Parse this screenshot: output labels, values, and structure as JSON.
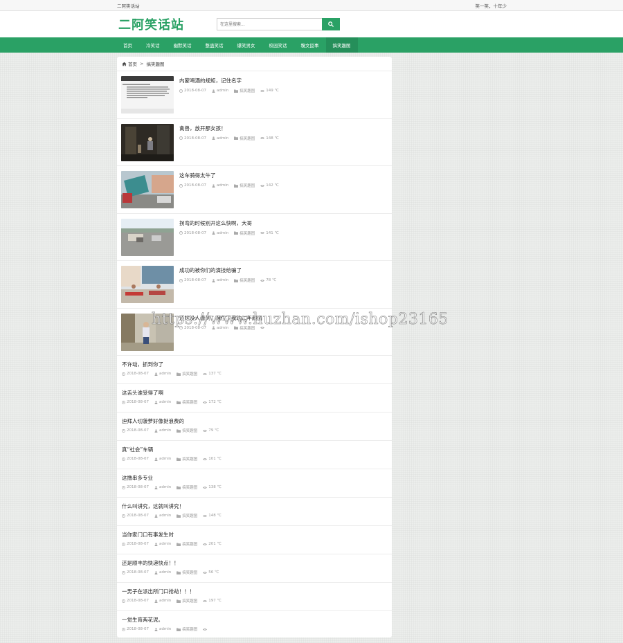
{
  "topbar": {
    "site_name": "二阿笑话站",
    "slogan": "笑一笑，十年少"
  },
  "header": {
    "logo": "二阿笑话站"
  },
  "search": {
    "placeholder": "在这里搜索..."
  },
  "nav": [
    "首页",
    "冷笑话",
    "幽默笑话",
    "整蛊笑话",
    "爆笑男女",
    "校园笑话",
    "糗文囧事",
    "搞笑趣图"
  ],
  "breadcrumb": {
    "home": "首页",
    "separator": ">",
    "current": "搞笑趣图"
  },
  "posts_with_image": [
    {
      "title": "内蒙喝酒的规矩，记住名字",
      "date": "2018-08-07",
      "author": "admin",
      "category": "搞笑趣图",
      "views": "149 ℃",
      "thumb": "chat-screenshot"
    },
    {
      "title": "禽兽，放开那女孩！",
      "date": "2018-08-07",
      "author": "admin",
      "category": "搞笑趣图",
      "views": "148 ℃",
      "thumb": "dark-room"
    },
    {
      "title": "这车骑得太牛了",
      "date": "2018-08-07",
      "author": "admin",
      "category": "搞笑趣图",
      "views": "142 ℃",
      "thumb": "street-truck"
    },
    {
      "title": "拐弯的时候别开这么快啊，大哥",
      "date": "2018-08-07",
      "author": "admin",
      "category": "搞笑趣图",
      "views": "141 ℃",
      "thumb": "road"
    },
    {
      "title": "成功的被你们的演技给骗了",
      "date": "2018-08-07",
      "author": "admin",
      "category": "搞笑趣图",
      "views": "78 ℃",
      "thumb": "shop-front"
    },
    {
      "title": "还好没人看到，保住了我的二年颜面",
      "date": "2018-08-07",
      "author": "admin",
      "category": "搞笑趣图",
      "views": "",
      "thumb": "indoor-kid"
    }
  ],
  "posts_text": [
    {
      "title": "不许动，抓到你了",
      "date": "2018-08-07",
      "author": "admin",
      "category": "搞笑趣图",
      "views": "137 ℃"
    },
    {
      "title": "这舌头谁受得了啊",
      "date": "2018-08-07",
      "author": "admin",
      "category": "搞笑趣图",
      "views": "172 ℃"
    },
    {
      "title": "迪拜人切菠萝好像挺浪费的",
      "date": "2018-08-07",
      "author": "admin",
      "category": "搞笑趣图",
      "views": "79 ℃"
    },
    {
      "title": "真“社会”车辆",
      "date": "2018-08-07",
      "author": "admin",
      "category": "搞笑趣图",
      "views": "101 ℃"
    },
    {
      "title": "这撸串多专业",
      "date": "2018-08-07",
      "author": "admin",
      "category": "搞笑趣图",
      "views": "138 ℃"
    },
    {
      "title": "什么叫讲究，这就叫讲究！",
      "date": "2018-08-07",
      "author": "admin",
      "category": "搞笑趣图",
      "views": "148 ℃"
    },
    {
      "title": "当你家门口有事发生时",
      "date": "2018-08-07",
      "author": "admin",
      "category": "搞笑趣图",
      "views": "201 ℃"
    },
    {
      "title": "还是顺丰的快递快点！！",
      "date": "2018-08-07",
      "author": "admin",
      "category": "搞笑趣图",
      "views": "56 ℃"
    },
    {
      "title": "一男子在派出所门口抢劫！！！",
      "date": "2018-08-07",
      "author": "admin",
      "category": "搞笑趣图",
      "views": "197 ℃"
    },
    {
      "title": "一觉生育两花泥。",
      "date": "2018-08-07",
      "author": "admin",
      "category": "搞笑趣图",
      "views": ""
    }
  ],
  "watermark": "https://www.huzhan.com/ishop23165",
  "colors": {
    "brand": "#2aa165",
    "nav_active": "#258f5a"
  }
}
